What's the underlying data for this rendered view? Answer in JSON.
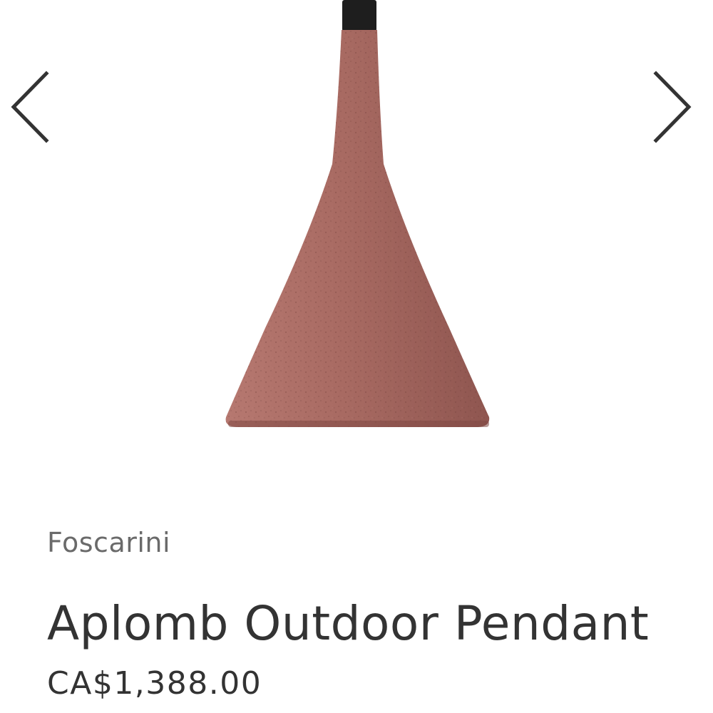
{
  "product": {
    "brand": "Foscarini",
    "title": "Aplomb Outdoor Pendant",
    "price": "CA$1,388.00",
    "image": {
      "alt": "Aplomb Outdoor Pendant",
      "colors": {
        "shade": "#a86a62",
        "shade_shadow": "#8f5650",
        "cord": "#1e1e1e"
      }
    }
  },
  "gallery": {
    "prev_icon": "chevron-left-icon",
    "next_icon": "chevron-right-icon"
  }
}
